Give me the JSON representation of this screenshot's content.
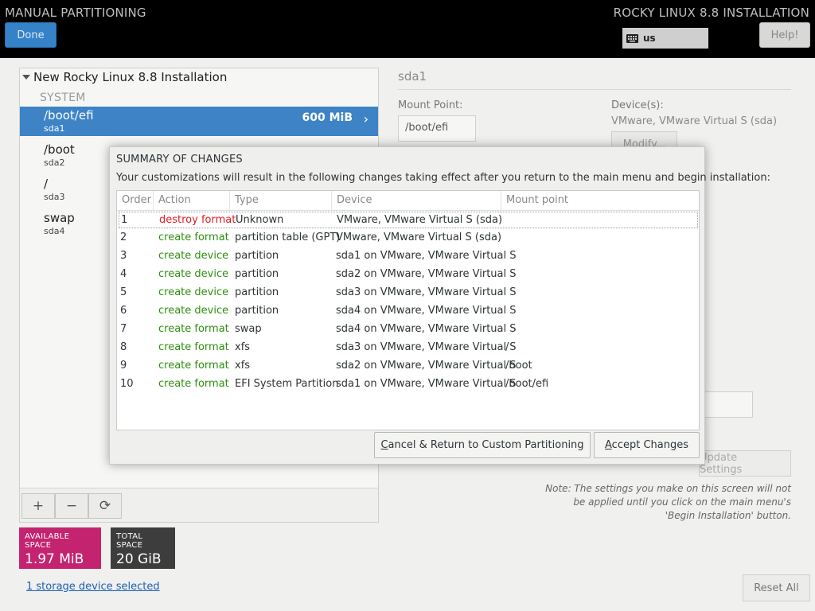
{
  "header": {
    "title_left": "MANUAL PARTITIONING",
    "title_right": "ROCKY LINUX 8.8 INSTALLATION",
    "done_label": "Done",
    "keyboard_layout": "us",
    "help_label": "Help!"
  },
  "left": {
    "install_title": "New Rocky Linux 8.8 Installation",
    "system_label": "SYSTEM",
    "mounts": [
      {
        "mount": "/boot/efi",
        "device": "sda1",
        "size": "600 MiB"
      },
      {
        "mount": "/boot",
        "device": "sda2"
      },
      {
        "mount": "/",
        "device": "sda3"
      },
      {
        "mount": "swap",
        "device": "sda4"
      }
    ],
    "toolbar": {
      "add": "+",
      "remove": "−",
      "refresh": "⟳"
    },
    "available_label": "AVAILABLE SPACE",
    "available_value": "1.97 MiB",
    "total_label": "TOTAL SPACE",
    "total_value": "20 GiB",
    "storage_link": "1 storage device selected"
  },
  "right": {
    "title": "sda1",
    "mount_point_label": "Mount Point:",
    "mount_point_value": "/boot/efi",
    "devices_label": "Device(s):",
    "devices_value": "VMware, VMware Virtual S (sda)",
    "modify_label": "Modify...",
    "update_label": "Update Settings",
    "note": "Note:  The settings you make on this screen will not be applied until you click on the main menu's 'Begin Installation' button.",
    "reset_label": "Reset All"
  },
  "dialog": {
    "title": "SUMMARY OF CHANGES",
    "description": "Your customizations will result in the following changes taking effect after you return to the main menu and begin installation:",
    "columns": [
      "Order",
      "Action",
      "Type",
      "Device",
      "Mount point"
    ],
    "rows": [
      {
        "order": "1",
        "action": "destroy format",
        "type": "Unknown",
        "device": "VMware, VMware Virtual S (sda)",
        "mount": ""
      },
      {
        "order": "2",
        "action": "create format",
        "type": "partition table (GPT)",
        "device": "VMware, VMware Virtual S (sda)",
        "mount": ""
      },
      {
        "order": "3",
        "action": "create device",
        "type": "partition",
        "device": "sda1 on VMware, VMware Virtual S",
        "mount": ""
      },
      {
        "order": "4",
        "action": "create device",
        "type": "partition",
        "device": "sda2 on VMware, VMware Virtual S",
        "mount": ""
      },
      {
        "order": "5",
        "action": "create device",
        "type": "partition",
        "device": "sda3 on VMware, VMware Virtual S",
        "mount": ""
      },
      {
        "order": "6",
        "action": "create device",
        "type": "partition",
        "device": "sda4 on VMware, VMware Virtual S",
        "mount": ""
      },
      {
        "order": "7",
        "action": "create format",
        "type": "swap",
        "device": "sda4 on VMware, VMware Virtual S",
        "mount": ""
      },
      {
        "order": "8",
        "action": "create format",
        "type": "xfs",
        "device": "sda3 on VMware, VMware Virtual S",
        "mount": "/"
      },
      {
        "order": "9",
        "action": "create format",
        "type": "xfs",
        "device": "sda2 on VMware, VMware Virtual S",
        "mount": "/boot"
      },
      {
        "order": "10",
        "action": "create format",
        "type": "EFI System Partition",
        "device": "sda1 on VMware, VMware Virtual S",
        "mount": "/boot/efi"
      }
    ],
    "cancel_label": "Cancel & Return to Custom Partitioning",
    "accept_label": "Accept Changes"
  },
  "colors": {
    "accent": "#3d83c6",
    "destroy": "#e01b24",
    "create": "#2f8f0f",
    "available": "#c4236f",
    "total": "#3d3d3d"
  }
}
